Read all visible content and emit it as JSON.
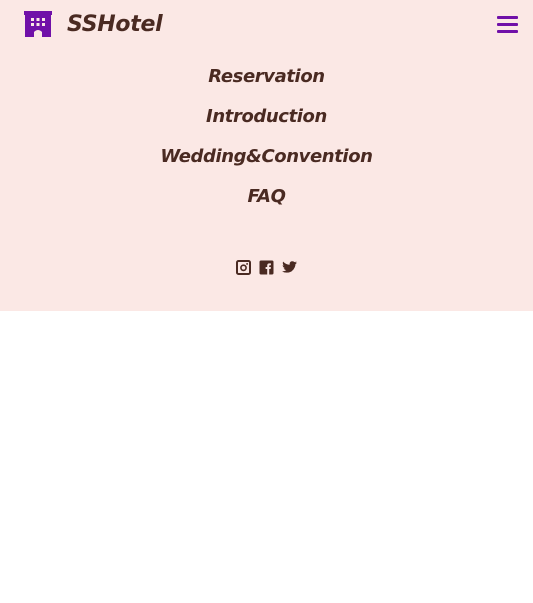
{
  "header": {
    "brand_name": "SSHotel",
    "brand_icon": "hotel-building-icon",
    "menu_icon": "hamburger-menu-icon"
  },
  "nav": {
    "items": [
      {
        "label": "Reservation"
      },
      {
        "label": "Introduction"
      },
      {
        "label": "Wedding&Convention"
      },
      {
        "label": "FAQ"
      }
    ]
  },
  "social": {
    "items": [
      {
        "icon": "instagram-icon"
      },
      {
        "icon": "facebook-icon"
      },
      {
        "icon": "twitter-icon"
      }
    ]
  },
  "colors": {
    "panel_background": "#fbe8e5",
    "text": "#4a2a22",
    "accent": "#7010a8"
  }
}
